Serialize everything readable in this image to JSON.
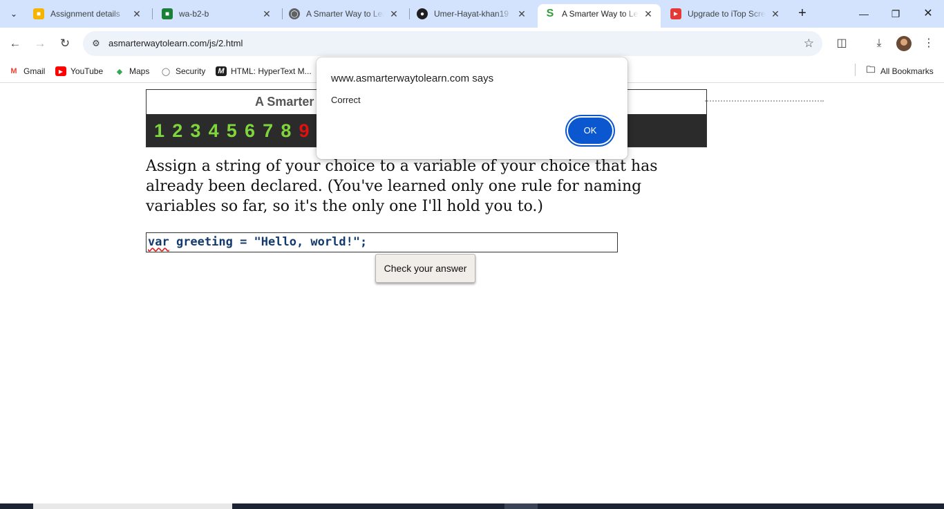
{
  "browser": {
    "tabs": [
      {
        "title": "Assignment details",
        "favicon": "classroom-icon",
        "color": "#34a853"
      },
      {
        "title": "wa-b2-b",
        "favicon": "classroom-icon",
        "color": "#188038"
      },
      {
        "title": "A Smarter Way to Lea",
        "favicon": "globe-icon",
        "color": "#5f6368"
      },
      {
        "title": "Umer-Hayat-khan19",
        "favicon": "github-icon",
        "color": "#1f1f1f"
      },
      {
        "title": "A Smarter Way to Lea",
        "favicon": "s-icon",
        "color": "#2e9e36",
        "active": true
      },
      {
        "title": "Upgrade to iTop Scre",
        "favicon": "itop-icon",
        "color": "#e53935"
      }
    ],
    "address": "asmarterwaytolearn.com/js/2.html",
    "bookmarks": [
      {
        "label": "Gmail",
        "icon": "gmail-icon"
      },
      {
        "label": "YouTube",
        "icon": "youtube-icon"
      },
      {
        "label": "Maps",
        "icon": "maps-icon"
      },
      {
        "label": "Security",
        "icon": "globe-icon"
      },
      {
        "label": "HTML: HyperText M...",
        "icon": "mdn-icon"
      }
    ],
    "all_bookmarks": "All Bookmarks"
  },
  "page": {
    "site_title": "A Smarter W",
    "exercise_numbers": [
      "1",
      "2",
      "3",
      "4",
      "5",
      "6",
      "7",
      "8",
      "9"
    ],
    "current_exercise": "9",
    "question": "Assign a string of your choice to a variable of your choice that has already been declared. (You've learned only one rule for naming variables so far, so it's the only one I'll hold you to.)",
    "answer_keyword": "var",
    "answer_rest": " greeting = \"Hello, world!\";",
    "check_button": "Check your answer"
  },
  "dialog": {
    "title": "www.asmarterwaytolearn.com says",
    "message": "Correct",
    "ok_label": "OK"
  }
}
